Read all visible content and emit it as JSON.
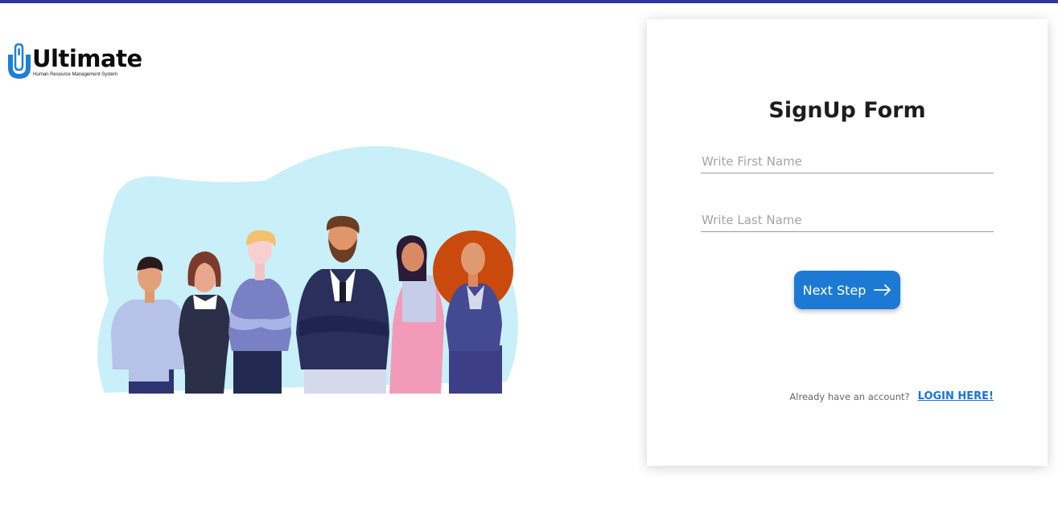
{
  "brand": {
    "name": "Ultimate",
    "tagline": "Human Resource Management System",
    "accent_color": "#2e35a3",
    "logo_blue": "#1f7fd6"
  },
  "illustration": {
    "icon": "team-people-illustration",
    "background_color": "#c9eff9"
  },
  "form": {
    "title": "SignUp Form",
    "first_name": {
      "placeholder": "Write First Name",
      "value": ""
    },
    "last_name": {
      "placeholder": "Write Last Name",
      "value": ""
    },
    "next_button": {
      "label": "Next Step",
      "icon": "arrow-right-icon",
      "color": "#1c7ad4"
    },
    "login_prompt": "Already have an account?",
    "login_link": "LOGIN HERE!"
  }
}
